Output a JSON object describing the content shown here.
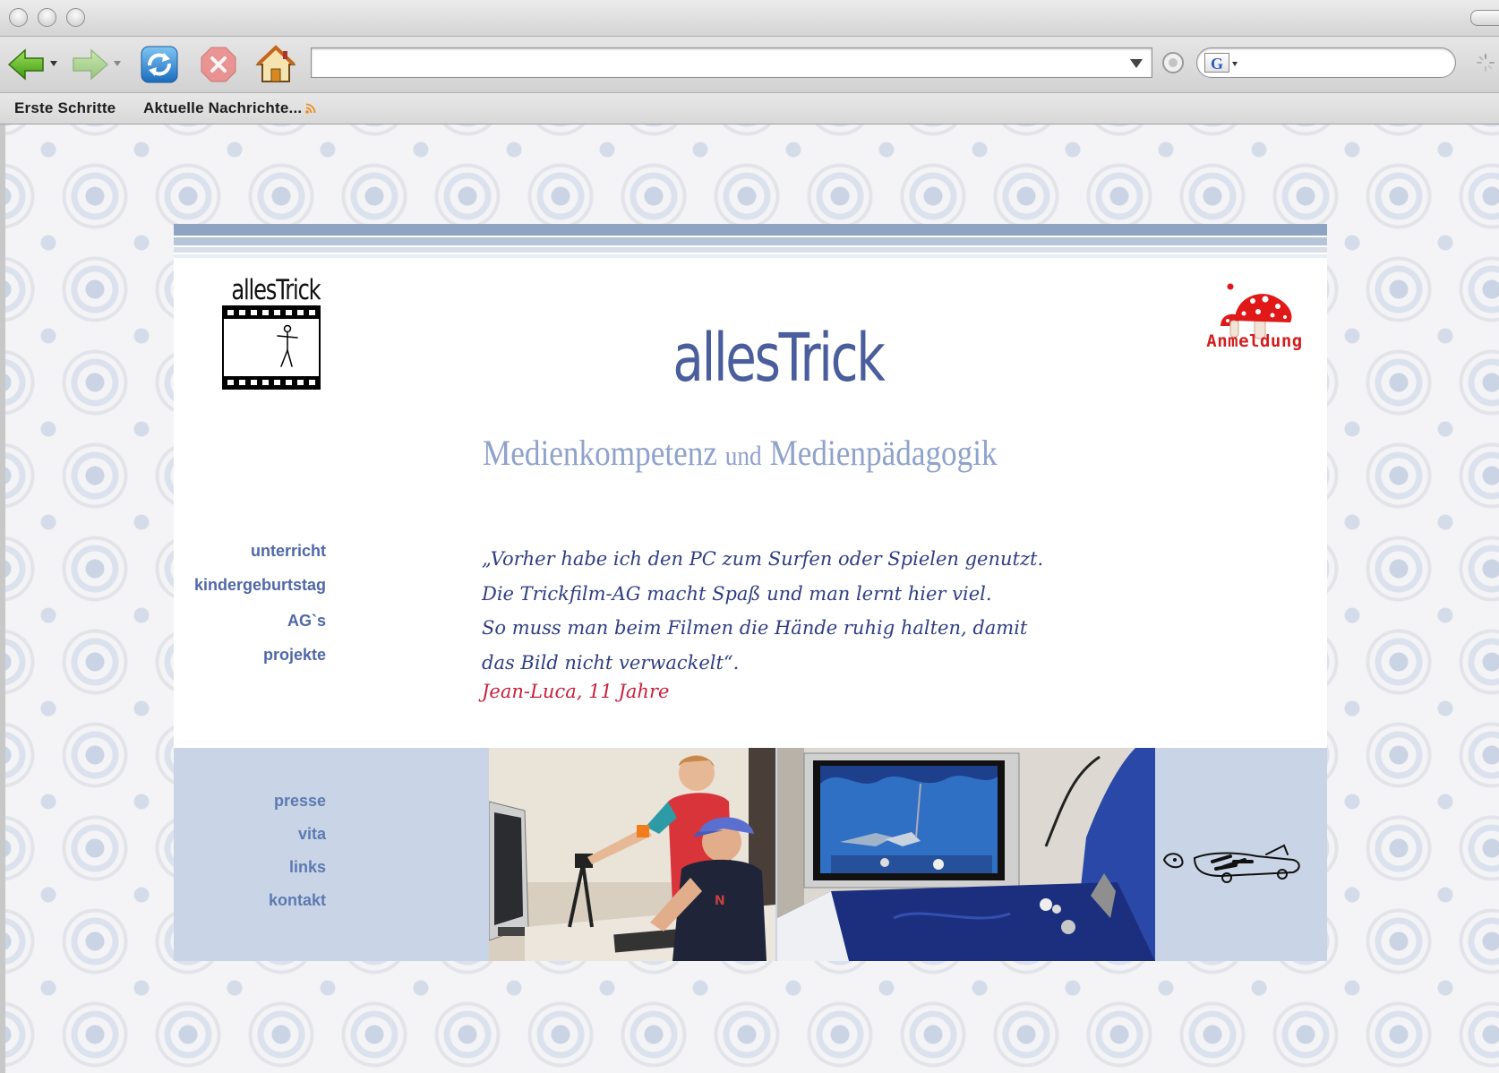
{
  "browser": {
    "url_value": "",
    "search_value": "",
    "search_engine_icon": "G",
    "bookmarks": [
      {
        "label": "Erste Schritte"
      },
      {
        "label": "Aktuelle Nachrichte...",
        "icon": "rss-icon"
      }
    ]
  },
  "site": {
    "logo_text": "allesTrick",
    "title": "allesTrick",
    "subtitle_part1": "Medienkompetenz",
    "subtitle_part2": "und",
    "subtitle_part3": "Medienpädagogik",
    "anmeldung_label": "Anmeldung",
    "quote_lines": [
      "„Vorher habe ich den PC  zum Surfen oder Spielen genutzt.",
      "Die Trickfilm-AG macht Spaß und man lernt hier viel.",
      "So muss man beim Filmen die Hände ruhig halten, damit",
      "das Bild nicht verwackelt“."
    ],
    "quote_author": "Jean-Luca, 11 Jahre",
    "nav_top": [
      "unterricht",
      "kindergeburtstag",
      "AG`s",
      "projekte"
    ],
    "nav_bottom": [
      "presse",
      "vita",
      "links",
      "kontakt"
    ]
  },
  "colors": {
    "title_blue": "#4a5d9c",
    "subtitle_blue": "#8fa2cb",
    "quote_blue": "#2f3e82",
    "author_red": "#c8203c",
    "anmeldung_red": "#d11f1f",
    "band_blue": "#c9d5e6"
  }
}
